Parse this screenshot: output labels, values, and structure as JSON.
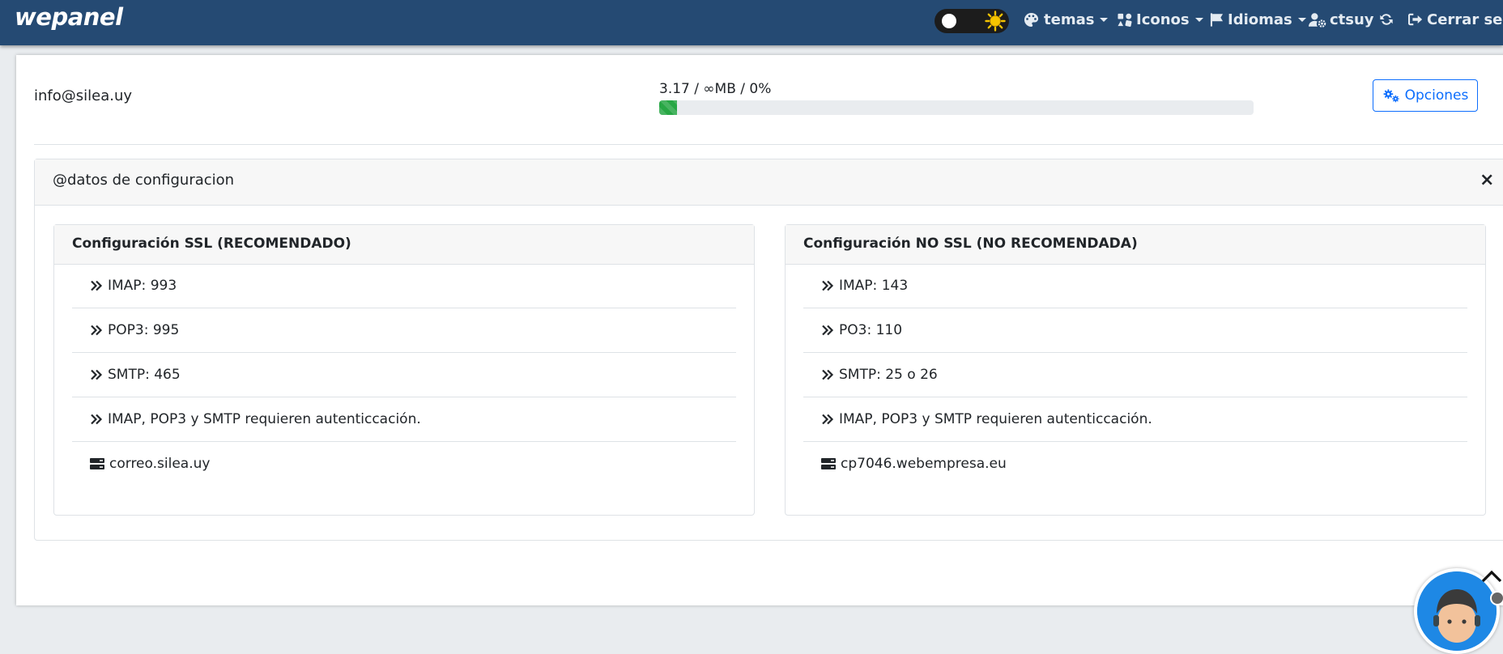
{
  "navbar": {
    "brand": "wepanel",
    "theme_toggle": {
      "mode": "light",
      "icons": [
        "toggle-knob-icon",
        "sun-icon"
      ]
    },
    "menu": {
      "themes": {
        "label": "temas",
        "icon": "palette-icon"
      },
      "icons": {
        "label": "Iconos",
        "icon": "icons-icon"
      },
      "languages": {
        "label": "Idiomas",
        "icon": "flag-icon"
      },
      "user": {
        "label": "ctsuy",
        "icon": "user-gear-icon"
      },
      "refresh": {
        "icon": "refresh-icon"
      },
      "logout": {
        "label": "Cerrar sesión",
        "icon": "sign-out-icon"
      }
    },
    "colors": {
      "background": "#254a73",
      "text": "#e4ebf2"
    }
  },
  "account": {
    "email": "info@silea.uy",
    "usage_text": "3.17 / ∞MB / 0%",
    "usage_progress_percent": 3,
    "options_button": {
      "label": "Opciones",
      "icon": "gears-icon"
    }
  },
  "config": {
    "title": "@datos de configuracion",
    "close_label": "×",
    "ssl": {
      "title": "Configuración SSL (RECOMENDADO)",
      "rows": [
        "IMAP: 993",
        "POP3: 995",
        "SMTP: 465",
        "IMAP, POP3 y SMTP requieren autenticcación."
      ],
      "server": "correo.silea.uy"
    },
    "no_ssl": {
      "title": "Configuración NO SSL (NO RECOMENDADA)",
      "rows": [
        "IMAP: 143",
        "PO3: 110",
        "SMTP: 25 o 26",
        "IMAP, POP3 y SMTP requieren autenticcación."
      ],
      "server": "cp7046.webempresa.eu"
    }
  },
  "colors": {
    "accent": "#0d6efd",
    "progress": "#28a745",
    "panel_header": "#f7f7f7",
    "border": "#dee2e6"
  }
}
